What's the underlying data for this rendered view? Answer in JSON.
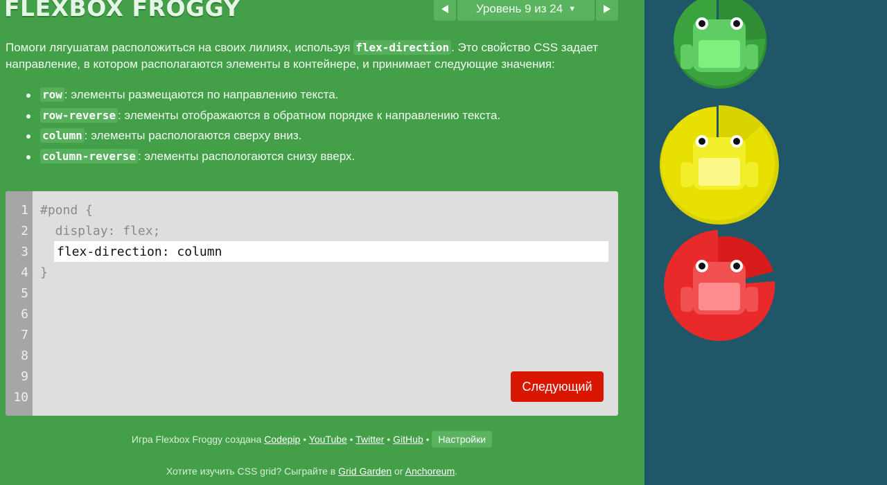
{
  "header": {
    "logo": "FLEXBOX FROGGY",
    "level_text": "Уровень 9 из 24",
    "level_caret": "▼"
  },
  "intro": {
    "text_before": "Помоги лягушатам расположиться на своих лилиях, используя ",
    "property": "flex-direction",
    "text_after": ". Это свойство CSS задает направление, в котором располагаются элементы в контейнере, и принимает следующие значения:"
  },
  "values": [
    {
      "code": "row",
      "desc": ": элементы размещаются по направлению текста."
    },
    {
      "code": "row-reverse",
      "desc": ": элементы отображаются в обратном порядке к направлению текста."
    },
    {
      "code": "column",
      "desc": ": элементы распологаются сверху вниз."
    },
    {
      "code": "column-reverse",
      "desc": ": элементы распологаются снизу вверх."
    }
  ],
  "editor": {
    "line_numbers": [
      "1",
      "2",
      "3",
      "4",
      "5",
      "6",
      "7",
      "8",
      "9",
      "10"
    ],
    "line1": "#pond {",
    "line2": "  display: flex;",
    "input_value": "flex-direction: column",
    "line4": "}",
    "next_button": "Следующий"
  },
  "footer": {
    "credits_prefix": "Игра Flexbox Froggy создана ",
    "link_codepip": "Codepip",
    "link_youtube": "YouTube",
    "link_twitter": "Twitter",
    "link_github": "GitHub",
    "separator": " • ",
    "settings": "Настройки",
    "grid_prefix": "Хотите изучить CSS grid? Сыграйте в ",
    "link_grid_garden": "Grid Garden",
    "grid_or": " or ",
    "link_anchoreum": "Anchoreum",
    "grid_end": "."
  },
  "colors": {
    "background": "#439f48",
    "pond": "#1f5768",
    "green_frog": "#6fdc6f",
    "yellow_frog": "#f8f23b",
    "red_frog": "#f26262",
    "next_button": "#d91600"
  }
}
